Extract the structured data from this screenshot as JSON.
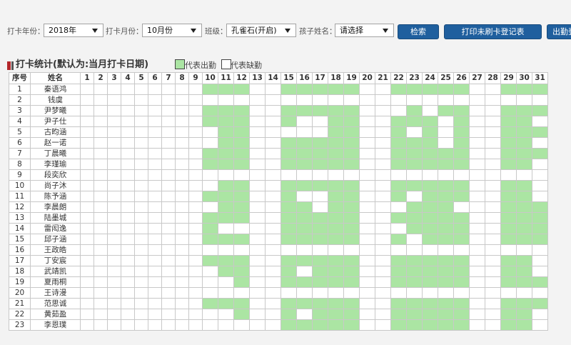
{
  "filters": {
    "year_label": "打卡年份：",
    "year_value": "2018年",
    "month_label": "打卡月份：",
    "month_value": "10月份",
    "class_label": "班级：",
    "class_value": "孔雀石(开启)",
    "child_label": "孩子姓名：",
    "child_value": "请选择"
  },
  "buttons": {
    "search": "检索",
    "print": "打印未刷卡登记表",
    "attendance": "出勤登"
  },
  "section": {
    "title": "打卡统计(默认为:当月打卡日期)",
    "legend_present": "代表出勤",
    "legend_absent": "代表缺勤"
  },
  "colors": {
    "present": "#abe5a3",
    "absent": "#ffffff",
    "button": "#1f5f9e",
    "marker": "#b3262a"
  },
  "icons": {
    "dropdown": "chevron-down-icon",
    "section_marker": "section-marker-icon"
  },
  "table": {
    "headers": {
      "seq": "序号",
      "name": "姓名"
    },
    "days": [
      1,
      2,
      3,
      4,
      5,
      6,
      7,
      8,
      9,
      10,
      11,
      12,
      13,
      14,
      15,
      16,
      17,
      18,
      19,
      20,
      21,
      22,
      23,
      24,
      25,
      26,
      27,
      28,
      29,
      30,
      31
    ],
    "students": [
      {
        "seq": 1,
        "name": "秦语鸿",
        "present_days": [
          10,
          11,
          12,
          15,
          16,
          17,
          18,
          19,
          22,
          23,
          24,
          25,
          26,
          29,
          30,
          31
        ]
      },
      {
        "seq": 2,
        "name": "钱虞",
        "present_days": []
      },
      {
        "seq": 3,
        "name": "尹梦曦",
        "present_days": [
          10,
          11,
          12,
          15,
          16,
          17,
          18,
          19,
          23,
          25,
          26,
          29,
          30,
          31
        ]
      },
      {
        "seq": 4,
        "name": "尹子仕",
        "present_days": [
          10,
          11,
          12,
          15,
          18,
          19,
          22,
          23,
          24,
          26,
          29,
          30
        ]
      },
      {
        "seq": 5,
        "name": "古昀涵",
        "present_days": [
          11,
          12,
          18,
          19,
          22,
          24,
          26,
          29,
          30,
          31
        ]
      },
      {
        "seq": 6,
        "name": "赵一诺",
        "present_days": [
          11,
          12,
          15,
          16,
          17,
          18,
          19,
          22,
          23,
          24,
          26,
          29,
          30
        ]
      },
      {
        "seq": 7,
        "name": "丁晨曦",
        "present_days": [
          10,
          11,
          12,
          15,
          16,
          17,
          18,
          19,
          22,
          23,
          24,
          25,
          26,
          29,
          30,
          31
        ]
      },
      {
        "seq": 8,
        "name": "李瑾瑜",
        "present_days": [
          10,
          11,
          12,
          15,
          16,
          17,
          18,
          19,
          22,
          23,
          24,
          25,
          26,
          29,
          30
        ]
      },
      {
        "seq": 9,
        "name": "段奕欣",
        "present_days": []
      },
      {
        "seq": 10,
        "name": "尚子沐",
        "present_days": [
          11,
          12,
          15,
          16,
          17,
          18,
          19,
          22,
          23,
          24,
          25,
          26,
          29,
          30
        ]
      },
      {
        "seq": 11,
        "name": "陈予涵",
        "present_days": [
          10,
          11,
          12,
          15,
          18,
          19,
          22,
          24,
          25,
          26,
          29,
          30
        ]
      },
      {
        "seq": 12,
        "name": "李晨朗",
        "present_days": [
          11,
          12,
          15,
          16,
          18,
          19,
          23,
          24,
          25,
          29,
          30,
          31
        ]
      },
      {
        "seq": 13,
        "name": "陆墨城",
        "present_days": [
          10,
          11,
          12,
          15,
          16,
          17,
          18,
          19,
          22,
          23,
          24,
          25,
          26,
          29,
          30,
          31
        ]
      },
      {
        "seq": 14,
        "name": "雷闳逸",
        "present_days": [
          10,
          15,
          16,
          17,
          18,
          19,
          23,
          24,
          25,
          26,
          29,
          30,
          31
        ]
      },
      {
        "seq": 15,
        "name": "邱子涵",
        "present_days": [
          10,
          11,
          12,
          15,
          16,
          17,
          18,
          19,
          22,
          24,
          25,
          26,
          29,
          30,
          31
        ]
      },
      {
        "seq": 16,
        "name": "王政皓",
        "present_days": []
      },
      {
        "seq": 17,
        "name": "丁安宸",
        "present_days": [
          10,
          11,
          12,
          15,
          16,
          17,
          18,
          19,
          22,
          23,
          24,
          25,
          26,
          29,
          30
        ]
      },
      {
        "seq": 18,
        "name": "武靖凯",
        "present_days": [
          11,
          12,
          15,
          17,
          18,
          19,
          22,
          23,
          24,
          25,
          26,
          29,
          30
        ]
      },
      {
        "seq": 19,
        "name": "夏雨桐",
        "present_days": [
          12,
          15,
          16,
          17,
          18,
          19,
          22,
          23,
          24,
          25,
          26,
          29,
          30,
          31
        ]
      },
      {
        "seq": 20,
        "name": "王诗漫",
        "present_days": []
      },
      {
        "seq": 21,
        "name": "范思诚",
        "present_days": [
          10,
          11,
          12,
          15,
          16,
          17,
          18,
          19,
          22,
          23,
          24,
          25,
          26,
          29,
          30,
          31
        ]
      },
      {
        "seq": 22,
        "name": "黄茹盈",
        "present_days": [
          12,
          15,
          17,
          18,
          19,
          22,
          23,
          24,
          25,
          26,
          29,
          30
        ]
      },
      {
        "seq": 23,
        "name": "李恩璞",
        "present_days": [
          15,
          16,
          17,
          18,
          19,
          22,
          23,
          24,
          25,
          26,
          29,
          30
        ]
      }
    ]
  }
}
